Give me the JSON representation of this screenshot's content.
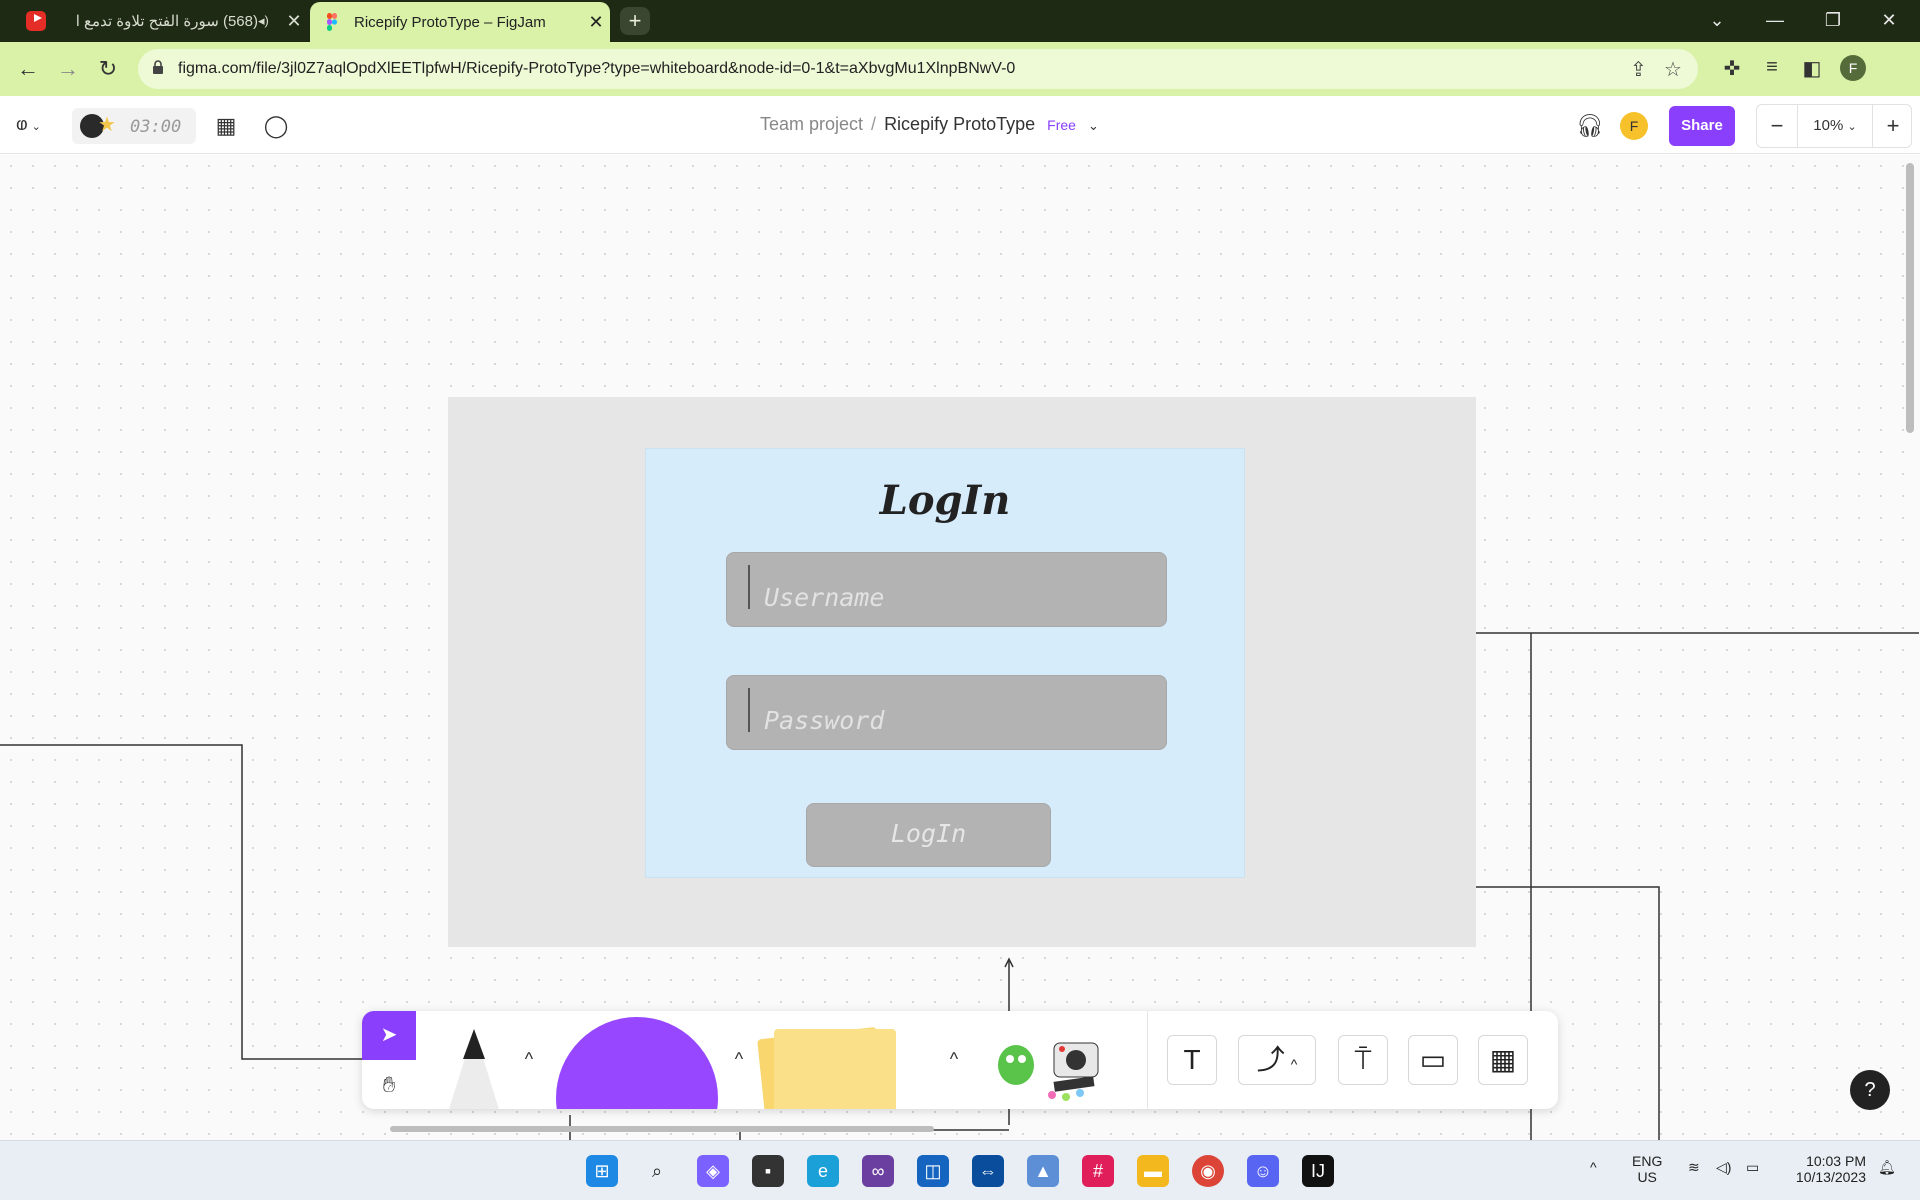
{
  "browser": {
    "tabs": [
      {
        "title": "(568) سورة الفتح تلاوة تدمع ا",
        "icon": "youtube-icon",
        "active": false
      },
      {
        "title": "Ricepify ProtoType – FigJam",
        "icon": "figma-icon",
        "active": true
      }
    ],
    "new_tab": "+",
    "url": "figma.com/file/3jl0Z7aqlOpdXlEETlpfwH/Ricepify-ProtoType?type=whiteboard&node-id=0-1&t=aXbvgMu1XlnpBNwV-0",
    "profile_initial": "F"
  },
  "figjam": {
    "timer": "03:00",
    "breadcrumb": {
      "team": "Team project",
      "separator": "/",
      "file": "Ricepify ProtoType",
      "plan": "Free"
    },
    "avatar_initial": "F",
    "share_label": "Share",
    "zoom": "10%",
    "zoom_out": "−",
    "zoom_in": "+"
  },
  "canvas": {
    "login_card": {
      "title": "LogIn",
      "username_placeholder": "Username",
      "password_placeholder": "Password",
      "button_label": "LogIn"
    }
  },
  "tools": {
    "text_tool": "T",
    "help": "?"
  },
  "taskbar": {
    "lang": "ENG",
    "region": "US",
    "time": "10:03 PM",
    "date": "10/13/2023"
  },
  "colors": {
    "accent": "#8a3ffc",
    "tab_active": "#d9f2a8",
    "card_bg": "#d6ecfb"
  }
}
